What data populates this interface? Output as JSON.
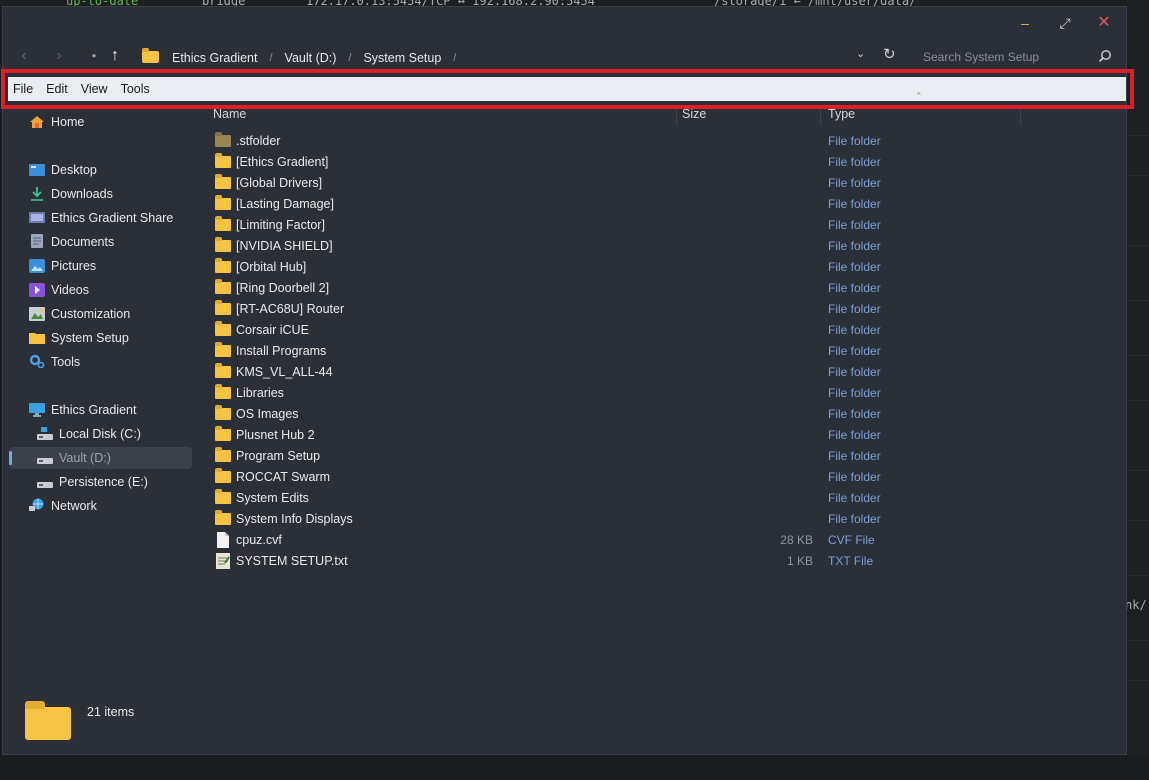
{
  "background": {
    "terminal_status": "up-to-date",
    "terminal_name": "bridge",
    "terminal_ports": "172.17.0.13:5454/TCP ↔ 192.168.2.90:5454",
    "terminal_path": "/storage/1 ← /mnt/user/data/",
    "terminal_right": "nk/"
  },
  "window": {
    "buttons": {
      "minimize": "–",
      "maximize": "⤢",
      "close": "✕"
    }
  },
  "toolbar": {
    "back_glyph": "‹",
    "forward_glyph": "›",
    "recent_glyph": "●",
    "up_glyph": "↑",
    "dropdown_glyph": "⌄",
    "refresh_glyph": "↻",
    "breadcrumb": [
      "Ethics Gradient",
      "Vault (D:)",
      "System Setup"
    ],
    "breadcrumb_sep": "/",
    "search_placeholder": "Search System Setup"
  },
  "menubar": {
    "items": [
      "File",
      "Edit",
      "View",
      "Tools"
    ],
    "caret": "⌃"
  },
  "sidebar": {
    "home": "Home",
    "quick": [
      "Desktop",
      "Downloads",
      "Ethics Gradient Share",
      "Documents",
      "Pictures",
      "Videos",
      "Customization",
      "System Setup",
      "Tools"
    ],
    "pc": "Ethics Gradient",
    "drives": [
      "Local Disk (C:)",
      "Vault (D:)",
      "Persistence (E:)"
    ],
    "network": "Network",
    "selected": "Vault (D:)"
  },
  "columns": {
    "name": "Name",
    "size": "Size",
    "type": "Type"
  },
  "files": [
    {
      "name": ".stfolder",
      "size": "",
      "type": "File folder",
      "kind": "folder-hidden"
    },
    {
      "name": "[Ethics Gradient]",
      "size": "",
      "type": "File folder",
      "kind": "folder"
    },
    {
      "name": "[Global Drivers]",
      "size": "",
      "type": "File folder",
      "kind": "folder"
    },
    {
      "name": "[Lasting Damage]",
      "size": "",
      "type": "File folder",
      "kind": "folder"
    },
    {
      "name": "[Limiting Factor]",
      "size": "",
      "type": "File folder",
      "kind": "folder"
    },
    {
      "name": "[NVIDIA SHIELD]",
      "size": "",
      "type": "File folder",
      "kind": "folder"
    },
    {
      "name": "[Orbital Hub]",
      "size": "",
      "type": "File folder",
      "kind": "folder"
    },
    {
      "name": "[Ring Doorbell 2]",
      "size": "",
      "type": "File folder",
      "kind": "folder"
    },
    {
      "name": "[RT-AC68U] Router",
      "size": "",
      "type": "File folder",
      "kind": "folder"
    },
    {
      "name": "Corsair iCUE",
      "size": "",
      "type": "File folder",
      "kind": "folder"
    },
    {
      "name": "Install Programs",
      "size": "",
      "type": "File folder",
      "kind": "folder"
    },
    {
      "name": "KMS_VL_ALL-44",
      "size": "",
      "type": "File folder",
      "kind": "folder"
    },
    {
      "name": "Libraries",
      "size": "",
      "type": "File folder",
      "kind": "folder-lib"
    },
    {
      "name": "OS Images",
      "size": "",
      "type": "File folder",
      "kind": "folder"
    },
    {
      "name": "Plusnet Hub 2",
      "size": "",
      "type": "File folder",
      "kind": "folder"
    },
    {
      "name": "Program Setup",
      "size": "",
      "type": "File folder",
      "kind": "folder"
    },
    {
      "name": "ROCCAT Swarm",
      "size": "",
      "type": "File folder",
      "kind": "folder"
    },
    {
      "name": "System Edits",
      "size": "",
      "type": "File folder",
      "kind": "folder"
    },
    {
      "name": "System Info Displays",
      "size": "",
      "type": "File folder",
      "kind": "folder"
    },
    {
      "name": "cpuz.cvf",
      "size": "28 KB",
      "type": "CVF File",
      "kind": "file"
    },
    {
      "name": "SYSTEM SETUP.txt",
      "size": "1 KB",
      "type": "TXT File",
      "kind": "text"
    }
  ],
  "status": {
    "count": "21 items"
  }
}
